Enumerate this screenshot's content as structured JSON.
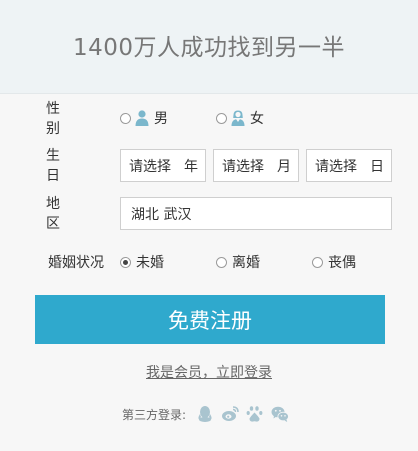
{
  "header": {
    "title": "1400万人成功找到另一半"
  },
  "form": {
    "gender": {
      "label": "性别",
      "options": [
        {
          "label": "男",
          "icon": "male-person-icon",
          "checked": false
        },
        {
          "label": "女",
          "icon": "female-person-icon",
          "checked": false
        }
      ]
    },
    "birthday": {
      "label": "生日",
      "year": {
        "placeholder": "请选择",
        "unit": "年"
      },
      "month": {
        "placeholder": "请选择",
        "unit": "月"
      },
      "day": {
        "placeholder": "请选择",
        "unit": "日"
      }
    },
    "region": {
      "label": "地区",
      "value": "湖北 武汉"
    },
    "marital": {
      "label": "婚姻状况",
      "options": [
        {
          "label": "未婚",
          "checked": true
        },
        {
          "label": "离婚",
          "checked": false
        },
        {
          "label": "丧偶",
          "checked": false
        }
      ]
    }
  },
  "submit_label": "免费注册",
  "login_link": "我是会员，立即登录",
  "third_party": {
    "label": "第三方登录:",
    "icons": [
      "qq-icon",
      "weibo-icon",
      "baidu-icon",
      "wechat-icon"
    ]
  },
  "colors": {
    "accent": "#2fa9cd",
    "icon": "#7bb7cc"
  }
}
